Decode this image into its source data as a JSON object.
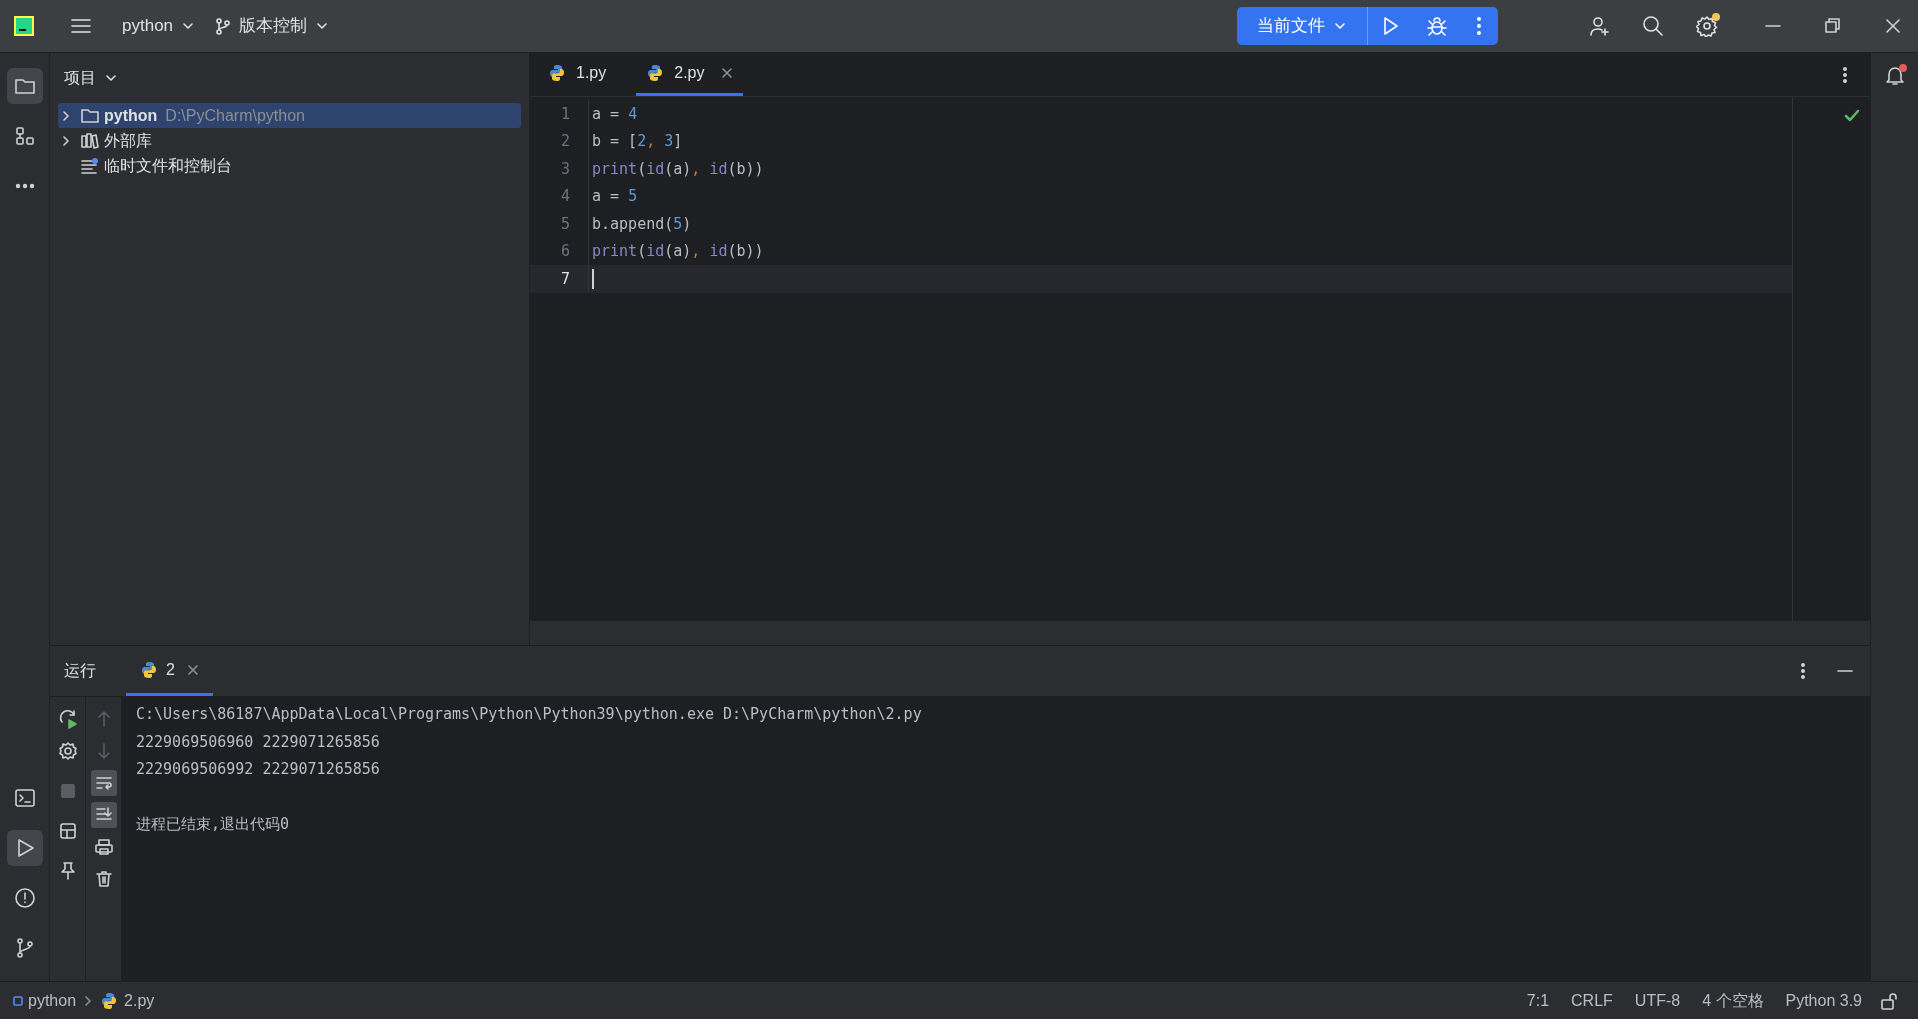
{
  "title_bar": {
    "project": "python",
    "vcs": "版本控制",
    "run_config": "当前文件"
  },
  "left_toolbar": [
    {
      "kind": "folder",
      "selected": true
    },
    {
      "kind": "structure",
      "selected": false
    },
    {
      "kind": "more",
      "selected": false
    }
  ],
  "left_toolbar_bottom": [
    {
      "kind": "terminal",
      "selected": false
    },
    {
      "kind": "run",
      "selected": true
    },
    {
      "kind": "problems",
      "selected": false
    },
    {
      "kind": "git",
      "selected": false
    }
  ],
  "project_panel": {
    "title": "项目",
    "tree": [
      {
        "kind": "folder",
        "label": "python",
        "path": "D:\\PyCharm\\python",
        "selected": true,
        "expandable": true
      },
      {
        "kind": "library",
        "label": "外部库",
        "selected": false,
        "expandable": true
      },
      {
        "kind": "scratches",
        "label": "临时文件和控制台",
        "selected": false,
        "expandable": false
      }
    ]
  },
  "editor": {
    "tabs": [
      {
        "label": "1.py",
        "selected": false
      },
      {
        "label": "2.py",
        "selected": true
      }
    ],
    "lines": [
      {
        "number": "1",
        "current": false,
        "tokens": [
          {
            "kind": "text",
            "text": "a = "
          },
          {
            "kind": "number",
            "text": "4"
          }
        ]
      },
      {
        "number": "2",
        "current": false,
        "tokens": [
          {
            "kind": "text",
            "text": "b = ["
          },
          {
            "kind": "number",
            "text": "2"
          },
          {
            "kind": "comma",
            "text": ", "
          },
          {
            "kind": "number",
            "text": "3"
          },
          {
            "kind": "text",
            "text": "]"
          }
        ]
      },
      {
        "number": "3",
        "current": false,
        "tokens": [
          {
            "kind": "builtin",
            "text": "print"
          },
          {
            "kind": "text",
            "text": "("
          },
          {
            "kind": "builtin",
            "text": "id"
          },
          {
            "kind": "text",
            "text": "(a)"
          },
          {
            "kind": "comma",
            "text": ", "
          },
          {
            "kind": "builtin",
            "text": "id"
          },
          {
            "kind": "text",
            "text": "(b))"
          }
        ]
      },
      {
        "number": "4",
        "current": false,
        "tokens": [
          {
            "kind": "text",
            "text": "a = "
          },
          {
            "kind": "number",
            "text": "5"
          }
        ]
      },
      {
        "number": "5",
        "current": false,
        "tokens": [
          {
            "kind": "text",
            "text": "b.append("
          },
          {
            "kind": "number",
            "text": "5"
          },
          {
            "kind": "text",
            "text": ")"
          }
        ]
      },
      {
        "number": "6",
        "current": false,
        "tokens": [
          {
            "kind": "builtin",
            "text": "print"
          },
          {
            "kind": "text",
            "text": "("
          },
          {
            "kind": "builtin",
            "text": "id"
          },
          {
            "kind": "text",
            "text": "(a)"
          },
          {
            "kind": "comma",
            "text": ", "
          },
          {
            "kind": "builtin",
            "text": "id"
          },
          {
            "kind": "text",
            "text": "(b))"
          }
        ]
      },
      {
        "number": "7",
        "current": true
      }
    ]
  },
  "run_panel": {
    "title": "运行",
    "tabs": [
      {
        "label": "2",
        "selected": true
      }
    ],
    "console": [
      {
        "lines": [
          "C:\\Users\\86187\\AppData\\Local\\Programs\\Python\\Python39\\python.exe D:\\PyCharm\\python\\2.py",
          "2229069506960 2229071265856",
          "2229069506992 2229071265856"
        ]
      },
      {
        "lines": [
          "进程已结束,退出代码0"
        ]
      }
    ]
  },
  "status_bar": {
    "breadcrumbs": [
      {
        "kind": "module",
        "label": "python"
      },
      {
        "kind": "python-file",
        "label": "2.py"
      }
    ],
    "items": [
      "7:1",
      "CRLF",
      "UTF-8",
      "4 个空格",
      "Python 3.9"
    ]
  }
}
